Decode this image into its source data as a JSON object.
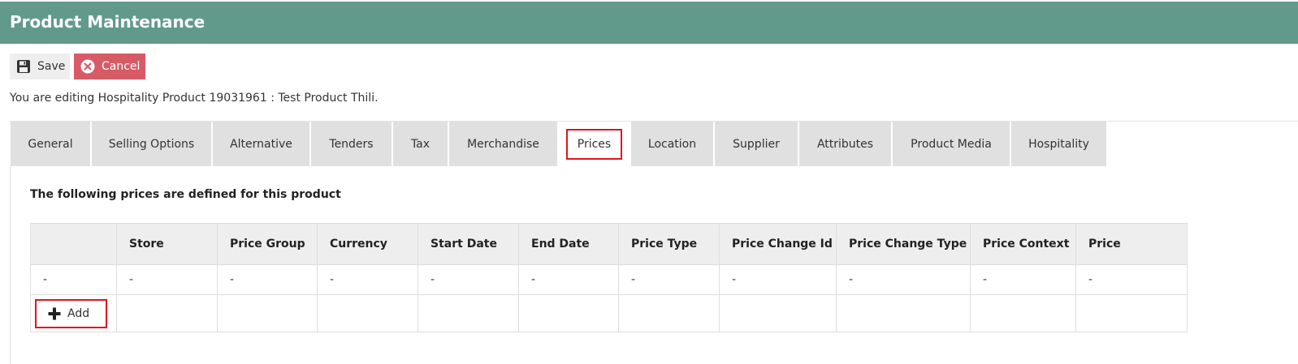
{
  "header": {
    "title": "Product Maintenance"
  },
  "toolbar": {
    "save_label": "Save",
    "cancel_label": "Cancel"
  },
  "editing_text": "You are editing Hospitality Product 19031961 : Test Product Thili.",
  "tabs": [
    {
      "label": "General"
    },
    {
      "label": "Selling Options"
    },
    {
      "label": "Alternative"
    },
    {
      "label": "Tenders"
    },
    {
      "label": "Tax"
    },
    {
      "label": "Merchandise"
    },
    {
      "label": "Prices",
      "active": true
    },
    {
      "label": "Location"
    },
    {
      "label": "Supplier"
    },
    {
      "label": "Attributes"
    },
    {
      "label": "Product Media"
    },
    {
      "label": "Hospitality"
    }
  ],
  "prices": {
    "title": "The following prices are defined for this product",
    "columns": [
      "",
      "Store",
      "Price Group",
      "Currency",
      "Start Date",
      "End Date",
      "Price Type",
      "Price Change Id",
      "Price Change Type",
      "Price Context",
      "Price"
    ],
    "rows": [
      [
        "-",
        "-",
        "-",
        "-",
        "-",
        "-",
        "-",
        "-",
        "-",
        "-",
        "-"
      ]
    ],
    "add_label": "Add"
  },
  "colors": {
    "header_bg": "#619a8b",
    "cancel_bg": "#d75b65",
    "highlight": "#e0141e"
  }
}
